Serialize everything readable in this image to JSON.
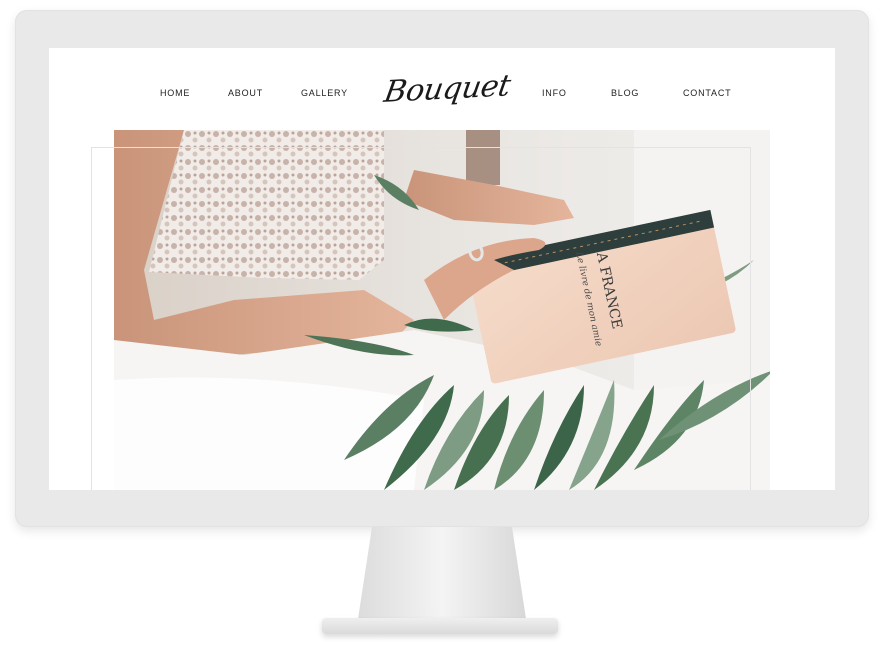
{
  "nav": {
    "home": "HOME",
    "about": "ABOUT",
    "gallery": "GALLERY",
    "info": "INFO",
    "blog": "BLOG",
    "contact": "CONTACT"
  },
  "logo": {
    "text": "Bouquet"
  },
  "hero": {
    "book_title": "A FRANCE",
    "book_subtitle": "Le livre de mon amie"
  },
  "colors": {
    "bezel": "#e9e9e9",
    "nav_text": "#222222",
    "leaf_dark": "#3f6a4c",
    "leaf_light": "#7d9c83",
    "book_cover": "#f3d7c4",
    "book_spine": "#2d3e3c"
  }
}
